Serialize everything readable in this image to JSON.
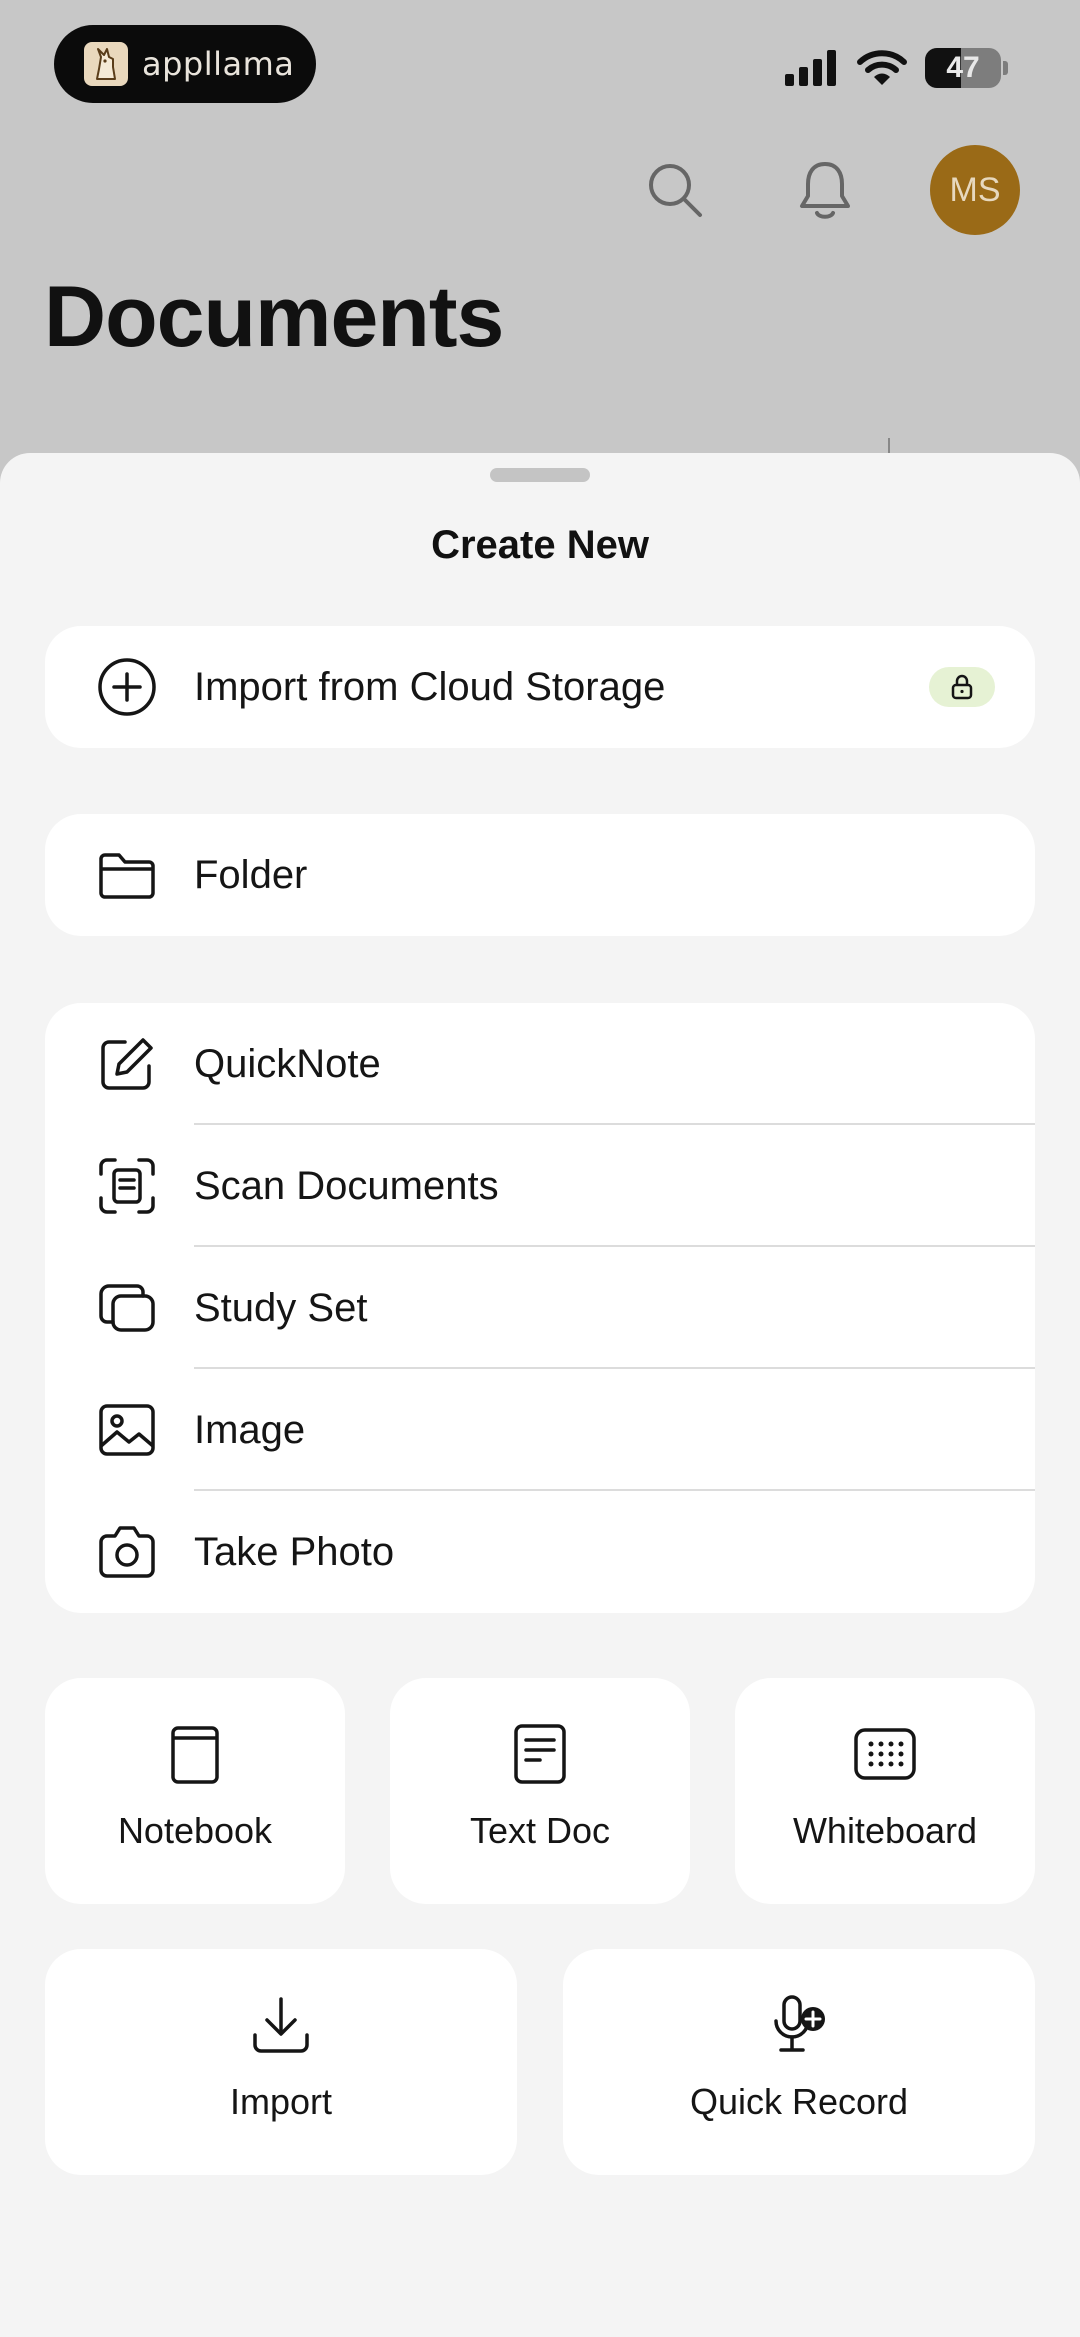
{
  "status_bar": {
    "app_name": "appllama",
    "battery_level": "47",
    "battery_fraction": 0.47
  },
  "header": {
    "title": "Documents",
    "avatar_initials": "MS",
    "avatar_color": "#9a6a17"
  },
  "sheet": {
    "title": "Create New",
    "cloud_import": {
      "label": "Import from Cloud Storage",
      "icon": "plus-circle-icon",
      "badge_icon": "lock-icon"
    },
    "folder": {
      "label": "Folder",
      "icon": "folder-icon"
    },
    "list_items": [
      {
        "label": "QuickNote",
        "icon": "edit-icon"
      },
      {
        "label": "Scan Documents",
        "icon": "scan-icon"
      },
      {
        "label": "Study Set",
        "icon": "cards-icon"
      },
      {
        "label": "Image",
        "icon": "image-icon"
      },
      {
        "label": "Take Photo",
        "icon": "camera-icon"
      }
    ],
    "tiles": [
      {
        "label": "Notebook",
        "icon": "notebook-icon"
      },
      {
        "label": "Text Doc",
        "icon": "text-doc-icon"
      },
      {
        "label": "Whiteboard",
        "icon": "whiteboard-icon"
      }
    ],
    "wide_tiles": [
      {
        "label": "Import",
        "icon": "download-icon"
      },
      {
        "label": "Quick Record",
        "icon": "mic-plus-icon"
      }
    ]
  },
  "colors": {
    "sheet_background": "#f4f4f4",
    "card_background": "#ffffff",
    "lock_badge": "#e6f2d4",
    "dim_background": "#c7c7c7"
  }
}
